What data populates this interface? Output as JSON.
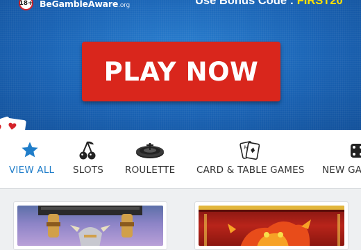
{
  "hero": {
    "age_badge": "18+",
    "gamble_aware_prefix": "BeGamble",
    "gamble_aware_main": "Aware",
    "gamble_aware_suffix": ".org",
    "bonus_prefix": "Use Bonus Code : ",
    "bonus_code": "FIRST20",
    "play_button_label": "PLAY NOW"
  },
  "categories": [
    {
      "label": "VIEW ALL",
      "icon": "star-icon",
      "active": true
    },
    {
      "label": "SLOTS",
      "icon": "cherries-icon",
      "active": false
    },
    {
      "label": "ROULETTE",
      "icon": "roulette-wheel-icon",
      "active": false
    },
    {
      "label": "CARD & TABLE GAMES",
      "icon": "playing-cards-icon",
      "active": false
    },
    {
      "label": "NEW GA",
      "icon": "dice-icon",
      "active": false
    }
  ],
  "games": [
    {
      "thumbnail": "viking-slot-thumbnail"
    },
    {
      "thumbnail": "dragon-slot-thumbnail"
    }
  ],
  "colors": {
    "accent_blue": "#1f7dc9",
    "play_red": "#d9261c",
    "bonus_yellow": "#ffe100",
    "hero_blue": "#1a63b4"
  }
}
